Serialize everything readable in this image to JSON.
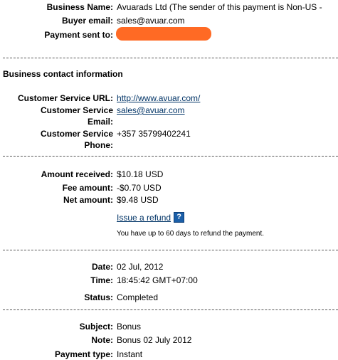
{
  "payment": {
    "business_name_label": "Business Name:",
    "business_name_value": "Avuarads Ltd (The sender of this payment is Non-US -",
    "buyer_email_label": "Buyer email:",
    "buyer_email_value": "sales@avuar.com",
    "payment_sent_to_label": "Payment sent to:"
  },
  "business_contact": {
    "heading": "Business contact information",
    "cs_url_label": "Customer Service URL:",
    "cs_url_value": "http://www.avuar.com/",
    "cs_email_label_line1": "Customer Service",
    "cs_email_label_line2": "Email:",
    "cs_email_value": "sales@avuar.com",
    "cs_phone_label_line1": "Customer Service",
    "cs_phone_label_line2": "Phone:",
    "cs_phone_value": "+357 35799402241"
  },
  "amounts": {
    "received_label": "Amount received:",
    "received_value": "$10.18 USD",
    "fee_label": "Fee amount:",
    "fee_value": "-$0.70 USD",
    "net_label": "Net amount:",
    "net_value": "$9.48 USD",
    "refund_link": "Issue a refund",
    "help_icon": "?",
    "refund_note": "You have up to 60 days to refund the payment."
  },
  "status": {
    "date_label": "Date:",
    "date_value": "02 Jul, 2012",
    "time_label": "Time:",
    "time_value": "18:45:42 GMT+07:00",
    "status_label": "Status:",
    "status_value": "Completed"
  },
  "details": {
    "subject_label": "Subject:",
    "subject_value": "Bonus",
    "note_label": "Note:",
    "note_value": "Bonus 02 July 2012",
    "payment_type_label": "Payment type:",
    "payment_type_value": "Instant"
  },
  "colors": {
    "link": "#003366",
    "redaction": "#ff6a24",
    "help_icon_bg": "#1b5fa8"
  }
}
